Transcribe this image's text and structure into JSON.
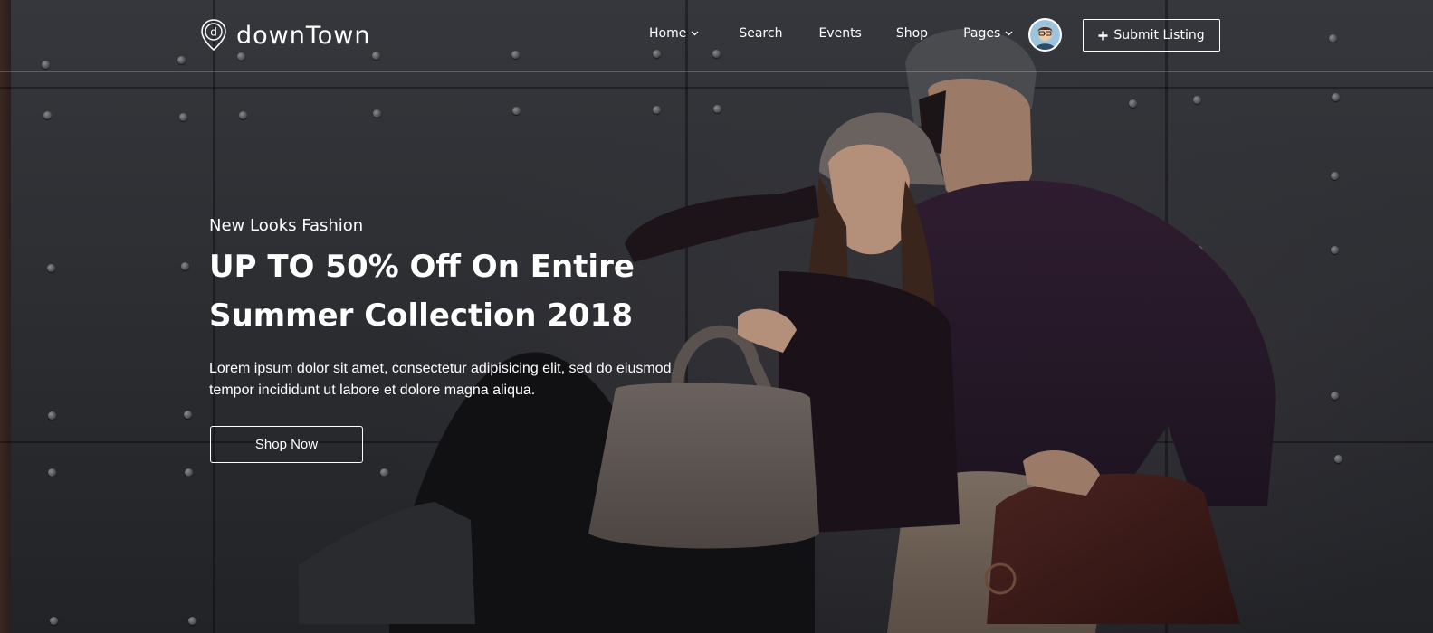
{
  "brand": {
    "name": "downTown",
    "logo_letter": "d",
    "logo_icon": "map-pin-icon"
  },
  "nav": {
    "items": [
      {
        "label": "Home",
        "dropdown": true
      },
      {
        "label": "Search",
        "dropdown": false
      },
      {
        "label": "Events",
        "dropdown": false
      },
      {
        "label": "Shop",
        "dropdown": false
      },
      {
        "label": "Pages",
        "dropdown": true
      }
    ],
    "dropdown_icon": "chevron-down-icon",
    "avatar_icon": "user-avatar-icon",
    "submit_icon": "plus-icon",
    "submit_label": "Submit Listing"
  },
  "hero": {
    "kicker": "New Looks Fashion",
    "headline_line1": "UP TO 50% Off On Entire",
    "headline_line2": "Summer Collection 2018",
    "description_line1": "Lorem ipsum dolor sit amet, consectetur adipisicing elit, sed do eiusmod",
    "description_line2": "tempor incididunt ut labore et dolore magna aliqua.",
    "cta_label": "Shop Now"
  },
  "colors": {
    "background": "#2b2c30",
    "text": "#ffffff",
    "sweater": "#2a1a2b",
    "bag_grey": "#5f5855",
    "bag_leather": "#3a1d1a"
  }
}
